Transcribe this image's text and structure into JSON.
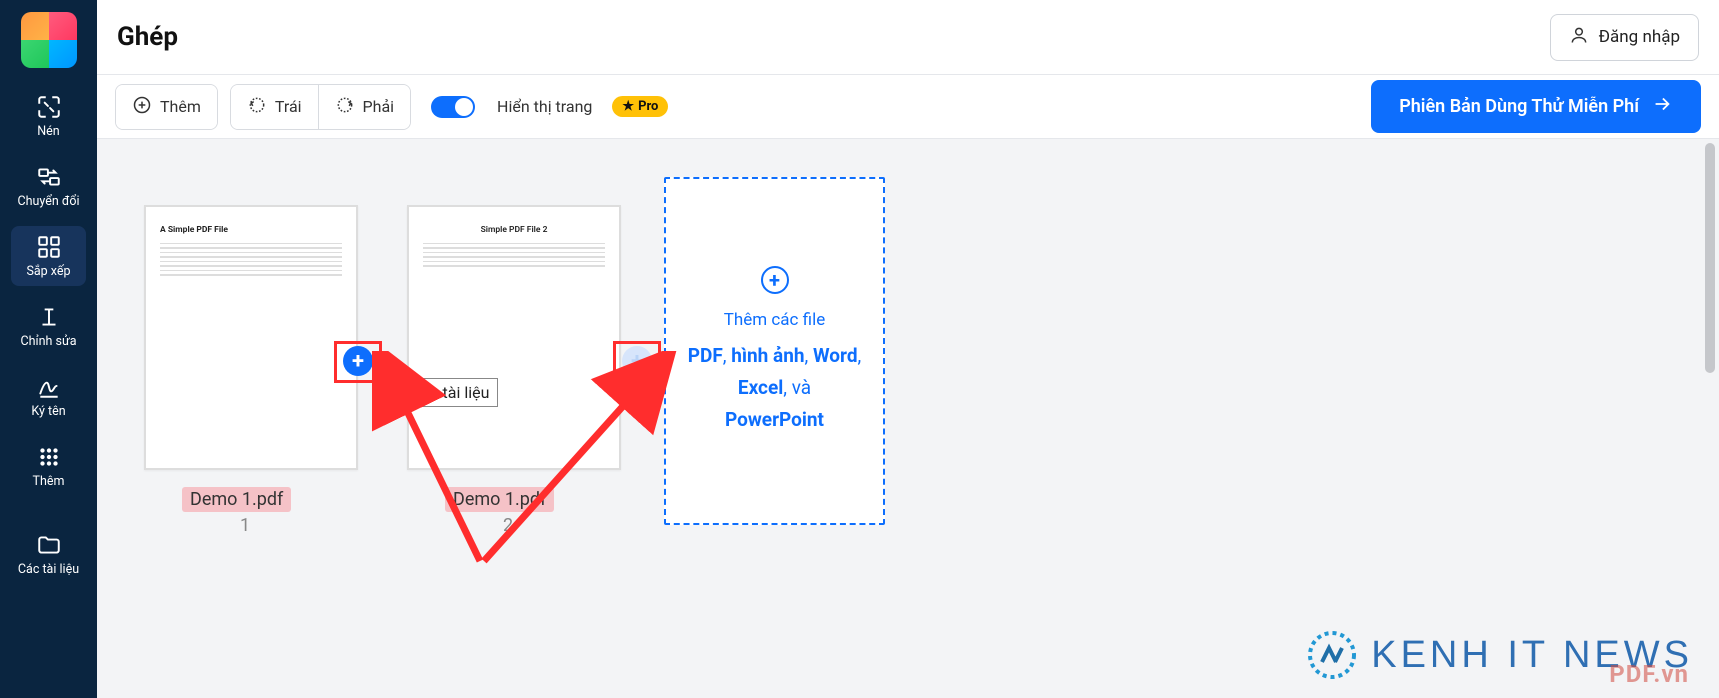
{
  "sidebar": {
    "items": [
      {
        "label": "Nén"
      },
      {
        "label": "Chuyển đổi"
      },
      {
        "label": "Sắp xếp"
      },
      {
        "label": "Chỉnh sửa"
      },
      {
        "label": "Ký tên"
      },
      {
        "label": "Thêm"
      },
      {
        "label": "Các tài liệu"
      }
    ]
  },
  "header": {
    "title": "Ghép",
    "login": "Đăng nhập"
  },
  "toolbar": {
    "add": "Thêm",
    "left": "Trái",
    "right": "Phải",
    "toggle_label": "Hiển thị trang",
    "pro": "Pro",
    "cta": "Phiên Bản Dùng Thử Miễn Phí"
  },
  "tooltip": {
    "add_file": "thêm tài liệu"
  },
  "pages": [
    {
      "preview_title": "A Simple PDF File",
      "file_label": "Demo 1.pdf",
      "index": "1"
    },
    {
      "preview_title": "Simple PDF File 2",
      "file_label": "Demo 1.pdf",
      "index": "2"
    }
  ],
  "dropzone": {
    "intro": "Thêm các file",
    "types": "PDF, hình ảnh, Word, Excel, và PowerPoint"
  },
  "watermark": {
    "text": "KENH IT NEWS",
    "sub": "PDF.vn"
  }
}
